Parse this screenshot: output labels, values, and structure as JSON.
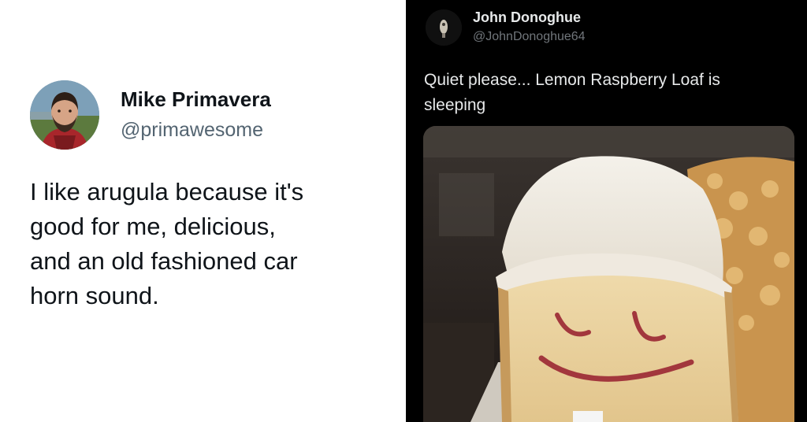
{
  "left_tweet": {
    "author_name": "Mike Primavera",
    "handle": "@primawesome",
    "text_lines": [
      "I like arugula because it's",
      "good for me, delicious,",
      "and an old fashioned car",
      "horn sound."
    ]
  },
  "right_tweet": {
    "author_name": "John Donoghue",
    "handle": "@JohnDonoghue64",
    "text_lines": [
      "Quiet please... Lemon Raspberry Loaf is",
      "sleeping"
    ]
  },
  "colors": {
    "left_bg": "#ffffff",
    "right_bg": "#000000",
    "name_light": "#0f1419",
    "handle_light": "#536471",
    "text_dark": "#e7e9ea",
    "handle_dark": "#71767b"
  }
}
